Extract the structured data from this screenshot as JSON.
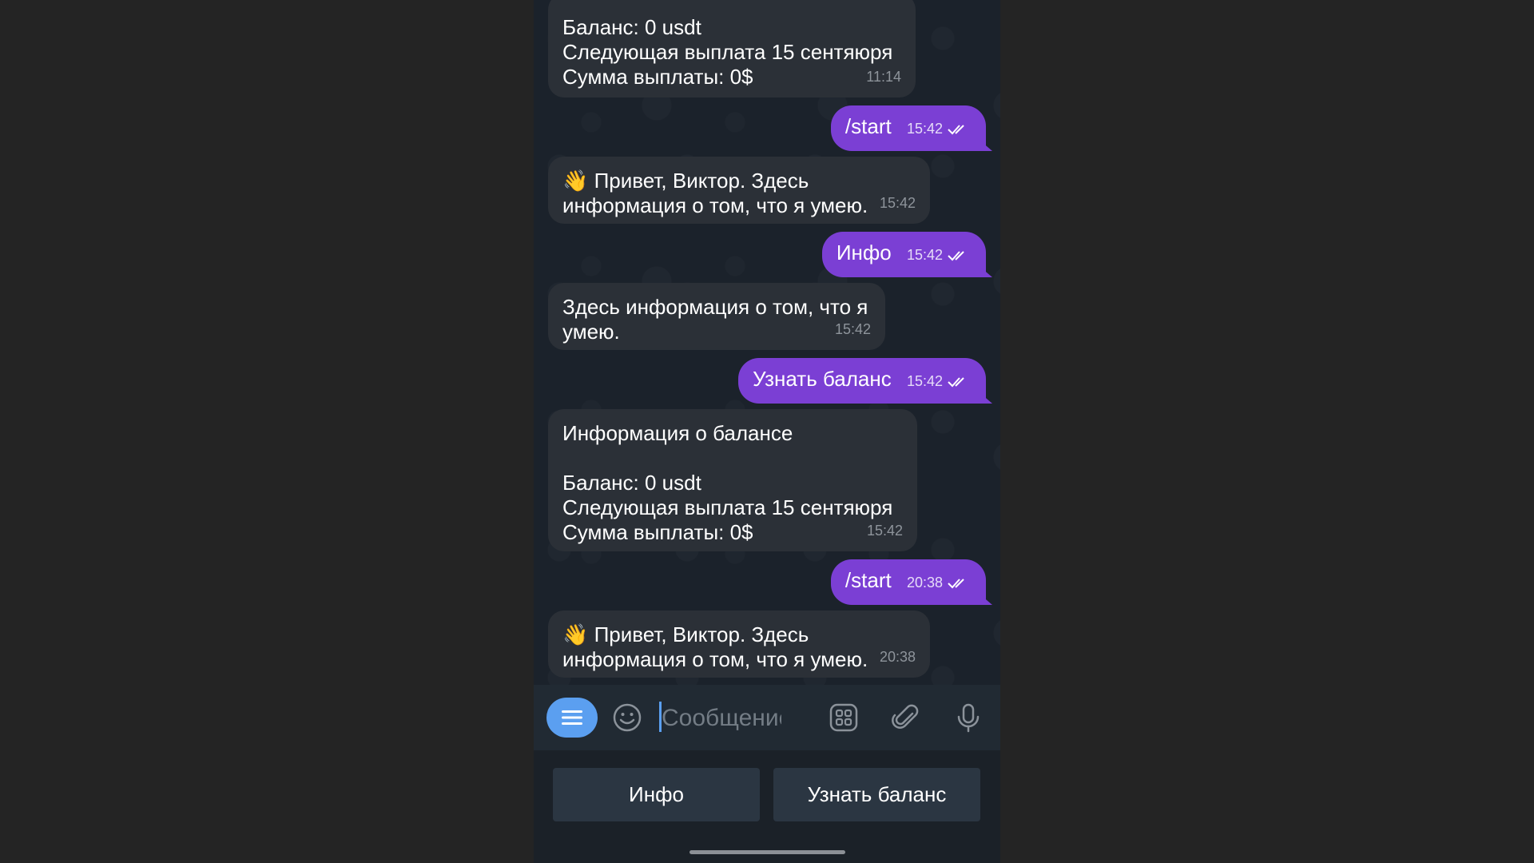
{
  "messages": [
    {
      "type": "in",
      "text": "Баланс: 0 usdt\nСледующая выплата 15 сентяюря\nСумма выплаты: 0$",
      "time": "11:14"
    },
    {
      "type": "out",
      "text": "/start",
      "time": "15:42"
    },
    {
      "type": "in",
      "emoji": "👋",
      "text": "Привет, Виктор. Здесь\nинформация о том, что я умею.",
      "time": "15:42"
    },
    {
      "type": "out",
      "text": "Инфо",
      "time": "15:42"
    },
    {
      "type": "in",
      "text": "Здесь информация о том, что я\nумею.",
      "time": "15:42"
    },
    {
      "type": "out",
      "text": "Узнать баланс",
      "time": "15:42"
    },
    {
      "type": "in",
      "text": "Информация о балансе\n\nБаланс: 0 usdt\nСледующая выплата 15 сентяюря\nСумма выплаты: 0$",
      "time": "15:42"
    },
    {
      "type": "out",
      "text": "/start",
      "time": "20:38"
    },
    {
      "type": "in",
      "emoji": "👋",
      "text": "Привет, Виктор. Здесь\nинформация о том, что я умею.",
      "time": "20:38"
    }
  ],
  "composer": {
    "placeholder": "Сообщение",
    "icons": [
      "menu-icon",
      "emoji-icon",
      "sticker-icon",
      "paperclip-icon",
      "microphone-icon"
    ]
  },
  "keyboard": {
    "buttons": [
      "Инфо",
      "Узнать баланс"
    ]
  },
  "colors": {
    "outgoing_bubble": "#7b3fd4",
    "incoming_bubble": "#2b3037",
    "accent": "#5b9ff0"
  }
}
